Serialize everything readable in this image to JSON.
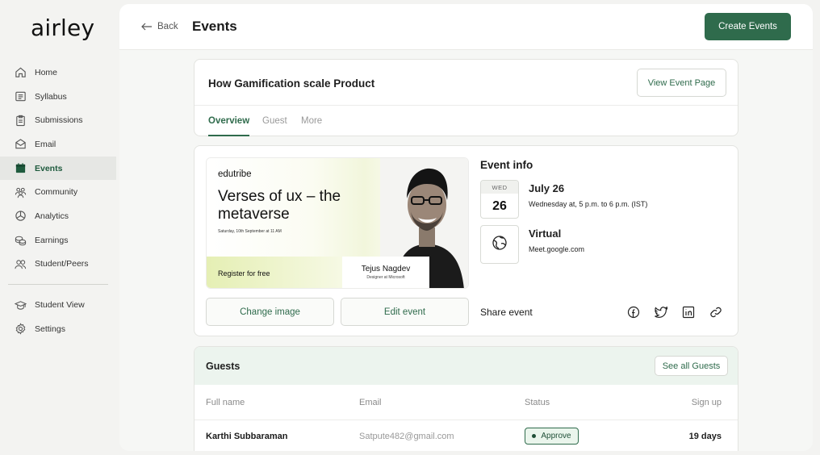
{
  "app": {
    "logo": "airley"
  },
  "sidebar": {
    "items": [
      {
        "label": "Home",
        "icon": "home-icon"
      },
      {
        "label": "Syllabus",
        "icon": "list-icon"
      },
      {
        "label": "Submissions",
        "icon": "clipboard-icon"
      },
      {
        "label": "Email",
        "icon": "envelope-icon"
      },
      {
        "label": "Events",
        "icon": "calendar-icon",
        "active": true
      },
      {
        "label": "Community",
        "icon": "people-icon"
      },
      {
        "label": "Analytics",
        "icon": "pie-chart-icon"
      },
      {
        "label": "Earnings",
        "icon": "coins-icon"
      },
      {
        "label": "Student/Peers",
        "icon": "users-icon"
      }
    ],
    "bottom_items": [
      {
        "label": "Student View",
        "icon": "graduation-cap-icon"
      },
      {
        "label": "Settings",
        "icon": "gear-icon"
      }
    ]
  },
  "header": {
    "back_label": "Back",
    "title": "Events",
    "create_label": "Create Events"
  },
  "event": {
    "title": "How Gamification scale Product",
    "view_page_label": "View Event Page",
    "tabs": [
      {
        "label": "Overview",
        "active": true
      },
      {
        "label": "Guest"
      },
      {
        "label": "More"
      }
    ]
  },
  "banner": {
    "brand": "edutribe",
    "heading": "Verses of ux – the metaverse",
    "date_line": "Saturday, 10th September at 11 AM",
    "register": "Register for free",
    "speaker_name": "Tejus Nagdev",
    "speaker_role": "Designer at Microsoft"
  },
  "actions": {
    "change_image": "Change image",
    "edit_event": "Edit event"
  },
  "info": {
    "title": "Event info",
    "dow": "WED",
    "day": "26",
    "date_main": "July 26",
    "date_sub": "Wednesday at, 5 p.m. to 6 p.m. (IST)",
    "location_main": "Virtual",
    "location_sub": "Meet.google.com"
  },
  "share": {
    "label": "Share event",
    "icons": [
      "facebook-icon",
      "twitter-icon",
      "linkedin-icon",
      "link-icon"
    ]
  },
  "guests": {
    "title": "Guests",
    "see_all_label": "See all Guests",
    "columns": [
      "Full name",
      "Email",
      "Status",
      "Sign up"
    ],
    "rows": [
      {
        "name": "Karthi Subbaraman",
        "email": "Satpute482@gmail.com",
        "status": "Approve",
        "signup": "19 days"
      }
    ]
  },
  "colors": {
    "accent": "#2f6b4c",
    "active_bg": "#e6e7e4",
    "guests_header": "#ecf4ee"
  }
}
